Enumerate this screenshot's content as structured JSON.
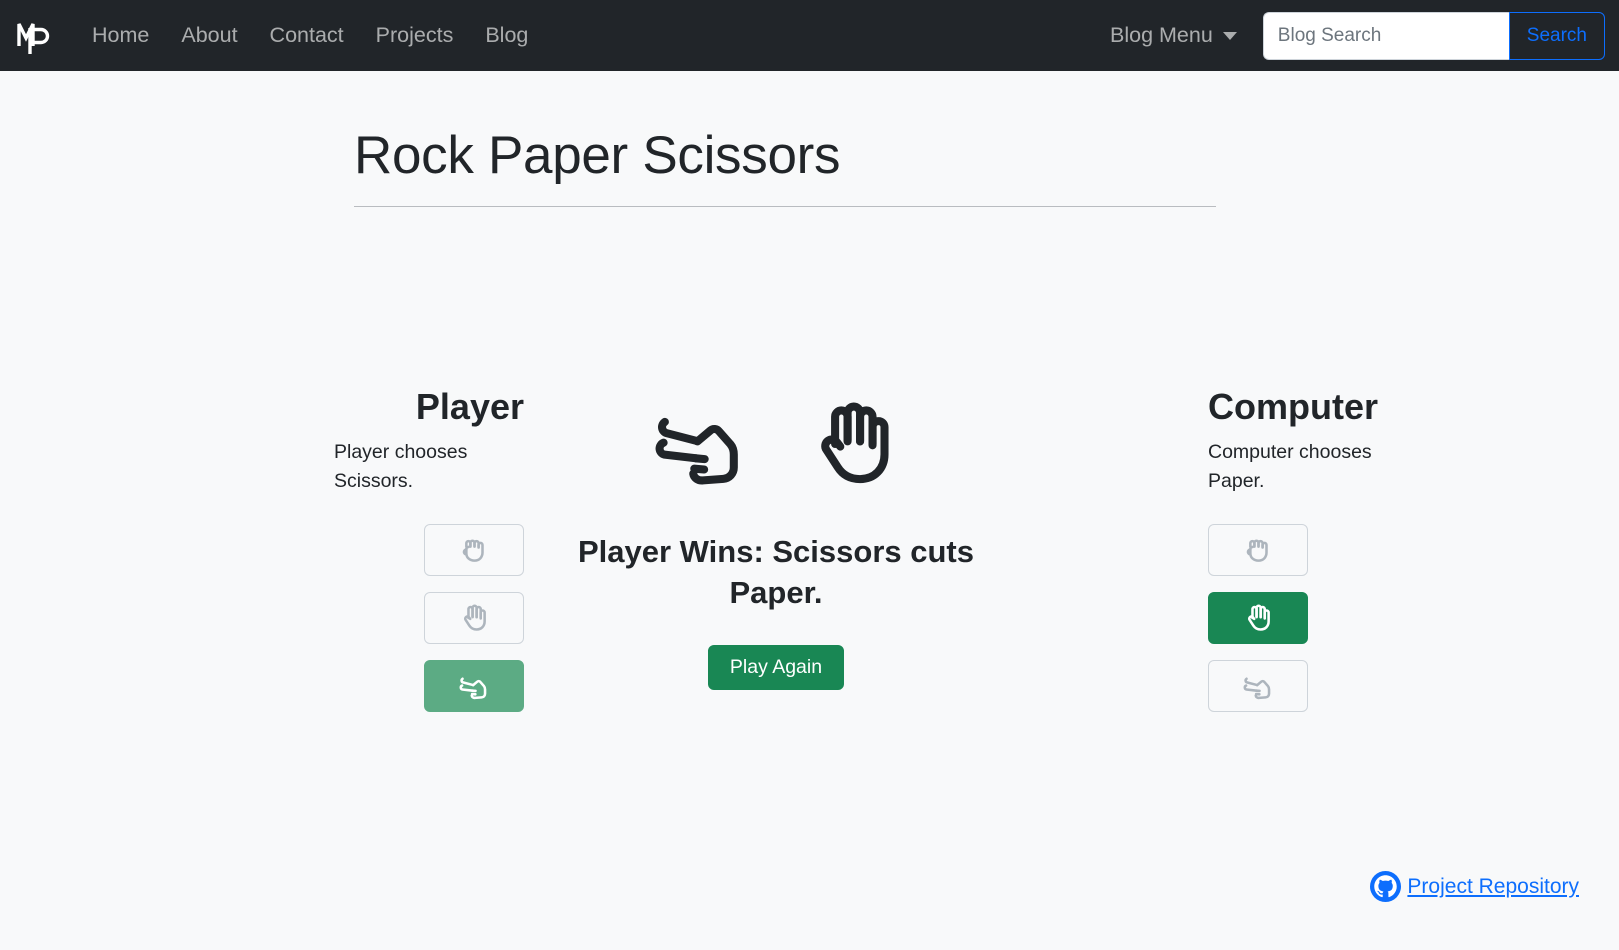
{
  "navbar": {
    "brand_icon": "mp-monogram-logo",
    "links": [
      {
        "label": "Home"
      },
      {
        "label": "About"
      },
      {
        "label": "Contact"
      },
      {
        "label": "Projects"
      },
      {
        "label": "Blog"
      }
    ],
    "blog_menu": {
      "label": "Blog Menu",
      "icon": "chevron-down-icon"
    },
    "search": {
      "placeholder": "Blog Search",
      "value": "",
      "button_label": "Search"
    },
    "colors": {
      "background": "#212529",
      "link": "rgba(255,255,255,0.62)",
      "search_button": "#0d6efd"
    }
  },
  "page": {
    "title": "Rock Paper Scissors"
  },
  "game": {
    "player": {
      "heading": "Player",
      "description": "Player chooses Scissors.",
      "choices": [
        {
          "name": "rock",
          "icon": "rock-hand-icon",
          "selected": false
        },
        {
          "name": "paper",
          "icon": "paper-hand-icon",
          "selected": false
        },
        {
          "name": "scissors",
          "icon": "scissors-hand-icon",
          "selected": true
        }
      ]
    },
    "computer": {
      "heading": "Computer",
      "description": "Computer chooses Paper.",
      "choices": [
        {
          "name": "rock",
          "icon": "rock-hand-icon",
          "selected": false
        },
        {
          "name": "paper",
          "icon": "paper-hand-icon",
          "selected": true
        },
        {
          "name": "scissors",
          "icon": "scissors-hand-icon",
          "selected": false
        }
      ]
    },
    "result": {
      "player_hand_icon": "scissors-hand-icon",
      "computer_hand_icon": "paper-hand-icon",
      "message": "Player Wins: Scissors cuts Paper.",
      "play_again_label": "Play Again"
    },
    "colors": {
      "selected_green": "#198754",
      "selected_green_muted": "#5cab84",
      "inactive_icon": "#adb5bd"
    }
  },
  "footer": {
    "repo_link_label": " Project Repository",
    "repo_icon": "github-icon",
    "link_color": "#0d6efd"
  }
}
